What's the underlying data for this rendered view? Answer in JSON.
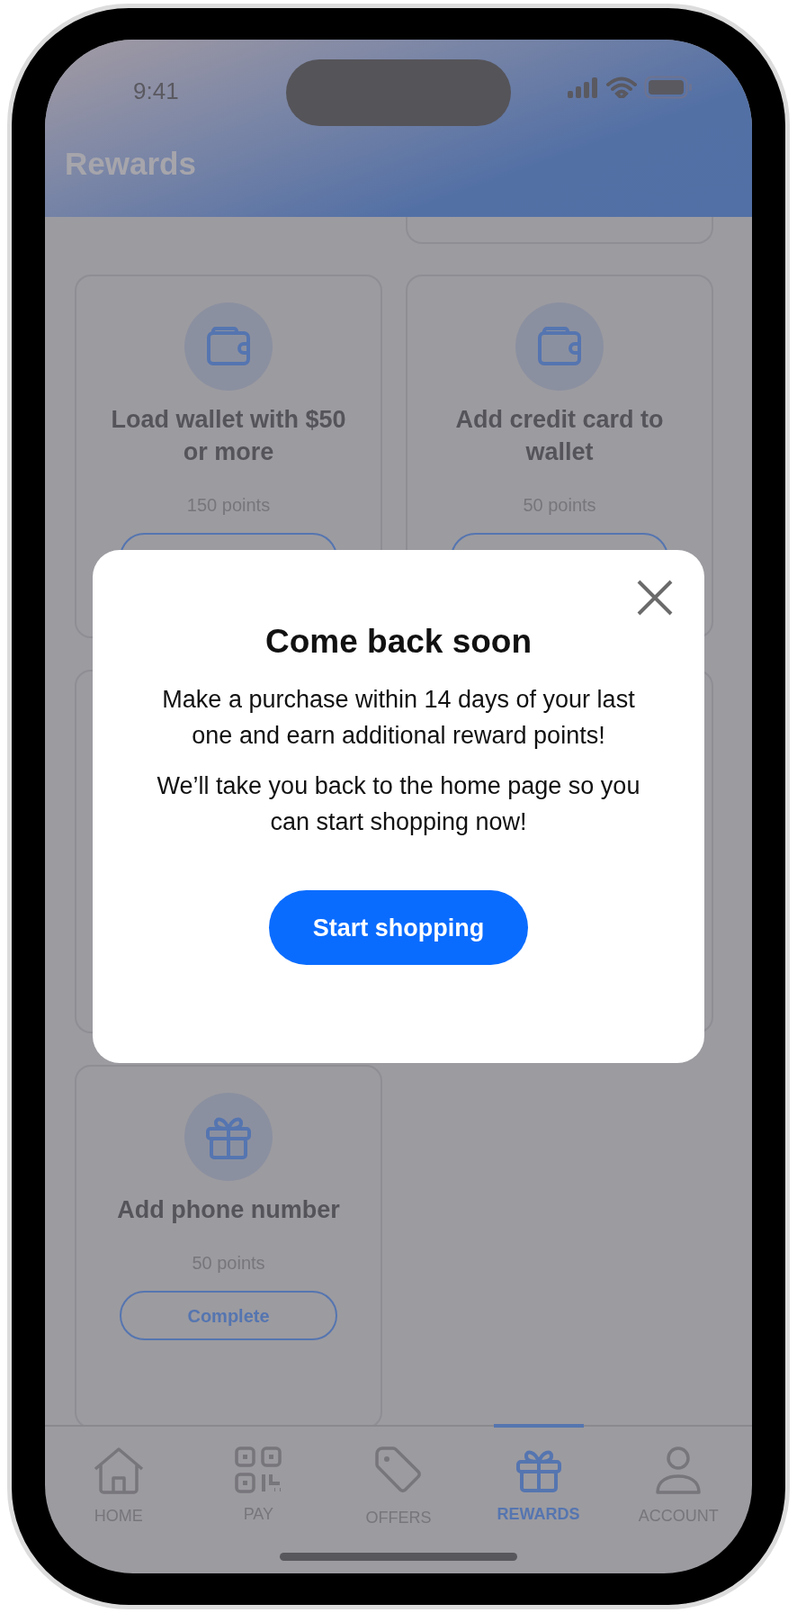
{
  "status_bar": {
    "time": "9:41"
  },
  "header": {
    "title": "Rewards"
  },
  "cards": [
    {
      "kind": "wallet",
      "title": "Load wallet with $50 or more",
      "points": "150 points"
    },
    {
      "kind": "wallet",
      "title": "Add credit card to wallet",
      "points": "50 points"
    },
    {
      "kind": "blank"
    },
    {
      "kind": "blank"
    },
    {
      "kind": "gift",
      "title": "Add phone number",
      "points": "50 points",
      "button_label": "Complete"
    }
  ],
  "dialog": {
    "title": "Come back soon",
    "paragraphs": [
      "Make a purchase within 14 days of your last one and earn additional reward points!",
      "We’ll take you back to the home page so you can start shopping now!"
    ],
    "button_label": "Start shopping"
  },
  "tabs": [
    {
      "kind": "home",
      "label": "HOME",
      "selected": false
    },
    {
      "kind": "qr",
      "label": "PAY",
      "selected": false
    },
    {
      "kind": "tag",
      "label": "OFFERS",
      "selected": false
    },
    {
      "kind": "gift",
      "label": "REWARDS",
      "selected": true
    },
    {
      "kind": "person",
      "label": "ACCOUNT",
      "selected": false
    }
  ]
}
